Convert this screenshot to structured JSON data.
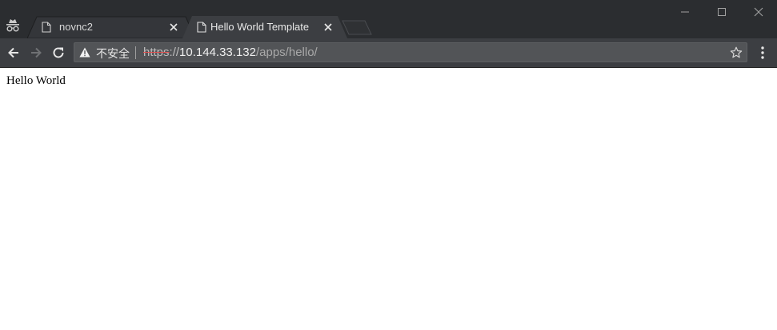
{
  "tabs": [
    {
      "title": "novnc2",
      "active": false,
      "icon": "document-icon"
    },
    {
      "title": "Hello World Template",
      "active": true,
      "icon": "document-icon"
    }
  ],
  "window": {
    "icon": "incognito-icon"
  },
  "toolbar": {
    "security_label": "不安全",
    "url": {
      "scheme": "https",
      "separator": "://",
      "host": "10.144.33.132",
      "path": "/apps/hello/"
    }
  },
  "page": {
    "body_text": "Hello World"
  },
  "colors": {
    "titlebar": "#2b2d30",
    "toolbar": "#3c3e42",
    "omnibox": "#525457",
    "https_strike": "#e05050"
  }
}
